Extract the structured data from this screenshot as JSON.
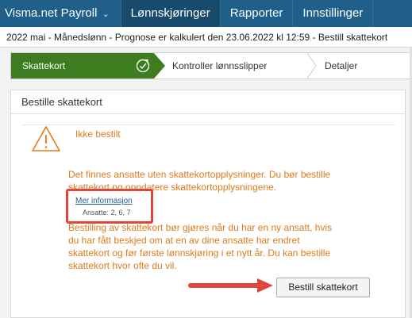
{
  "nav": {
    "app_name": "Visma.net Payroll",
    "items": [
      "Lønnskjøringer",
      "Rapporter",
      "Innstillinger"
    ],
    "active_index": 0
  },
  "subtitle": "2022 mai - Månedslønn - Prognose er kalkulert den 23.06.2022 kl 12:59 - Bestill skattekort",
  "stepper": {
    "steps": [
      "Skattekort",
      "Kontroller lønnsslipper",
      "Detaljer"
    ],
    "active_color": "#3e7d1f"
  },
  "card": {
    "title": "Bestille skattekort",
    "status": "Ikke bestilt",
    "message": "Det finnes ansatte uten skattekortopplysninger. Du bør bestille skattekort og oppdatere skattekortopplysningene.",
    "more_info": "Mer informasjon",
    "employees": "Ansatte: 2, 6, 7",
    "details": "Bestilling av skattekort bør gjøres når du har en ny ansatt, hvis du har fått beskjed om at en av dine ansatte har endret skattekort og før første lønnskjøring i et nytt år. Du kan bestille skattekort hvor ofte du vil.",
    "button": "Bestill skattekort",
    "warning_color": "#e07b1a",
    "highlight_color": "#e0443b"
  }
}
